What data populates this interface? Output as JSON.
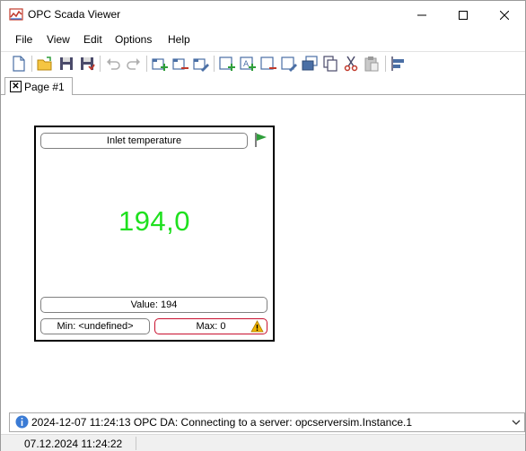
{
  "window": {
    "title": "OPC Scada Viewer",
    "controls": [
      "minimize-icon",
      "maximize-icon",
      "close-icon"
    ]
  },
  "menu": [
    "File",
    "View",
    "Edit",
    "Options",
    "Help"
  ],
  "toolbar": {
    "buttons": [
      "new-icon",
      "open-icon",
      "save-icon",
      "save-all-icon",
      "undo-icon",
      "redo-icon",
      "add-page-icon",
      "remove-page-icon",
      "rename-page-icon",
      "add-item-icon",
      "add-text-icon",
      "remove-item-icon",
      "edit-item-icon",
      "bring-front-icon",
      "copy-icon",
      "cut-icon",
      "paste-icon",
      "align-icon"
    ]
  },
  "tabs": [
    {
      "label": "Page #1",
      "close_glyph": "✕"
    }
  ],
  "widget": {
    "title": "Inlet temperature",
    "value_display": "194,0",
    "value_color": "#1fe01f",
    "value_label": "Value: 194",
    "min_label": "Min: <undefined>",
    "max_label": "Max: 0",
    "max_border_color": "#c8102e",
    "flag_color": "#2e9e3a",
    "warning_icon": "warning-icon"
  },
  "status": {
    "message": "2024-12-07 11:24:13 OPC DA: Connecting to a server: opcserversim.Instance.1",
    "datetime": "07.12.2024 11:24:22"
  }
}
